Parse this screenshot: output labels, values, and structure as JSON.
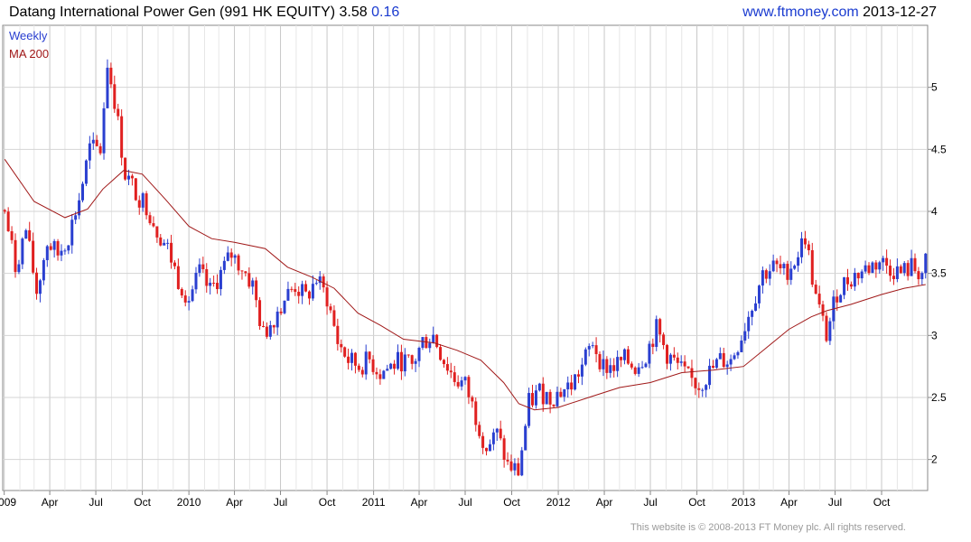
{
  "header": {
    "name": "Datang International Power Gen (991 HK EQUITY)",
    "price": "3.58",
    "change": "0.16",
    "site": "www.ftmoney.com",
    "date": "2013-12-27"
  },
  "footer": {
    "copyright": "This website is © 2008-2013 FT Money plc. All rights reserved."
  },
  "colors": {
    "up": "#2a3fd0",
    "down": "#e02020",
    "ma": "#a01818",
    "grid": "#d4d4d4",
    "axis": "#888888"
  },
  "chart_data": {
    "type": "line",
    "title": "Datang International Power Gen (991 HK EQUITY)",
    "legend": [
      "Weekly",
      "MA 200"
    ],
    "legend_position": "top-left",
    "y_axis_position": "right",
    "grid": true,
    "ylim": [
      1.75,
      5.5
    ],
    "xlim": [
      "2008-12-29",
      "2013-12-31"
    ],
    "yticks": [
      2,
      2.5,
      3,
      3.5,
      4,
      4.5,
      5
    ],
    "xticks": [
      {
        "label": "2009",
        "date": "2009-01-01"
      },
      {
        "label": "Apr",
        "date": "2009-04-01"
      },
      {
        "label": "Jul",
        "date": "2009-07-01"
      },
      {
        "label": "Oct",
        "date": "2009-10-01"
      },
      {
        "label": "2010",
        "date": "2010-01-01"
      },
      {
        "label": "Apr",
        "date": "2010-04-01"
      },
      {
        "label": "Jul",
        "date": "2010-07-01"
      },
      {
        "label": "Oct",
        "date": "2010-10-01"
      },
      {
        "label": "2011",
        "date": "2011-01-01"
      },
      {
        "label": "Apr",
        "date": "2011-04-01"
      },
      {
        "label": "Jul",
        "date": "2011-07-01"
      },
      {
        "label": "Oct",
        "date": "2011-10-01"
      },
      {
        "label": "2012",
        "date": "2012-01-01"
      },
      {
        "label": "Apr",
        "date": "2012-04-01"
      },
      {
        "label": "Jul",
        "date": "2012-07-01"
      },
      {
        "label": "Oct",
        "date": "2012-10-01"
      },
      {
        "label": "2013",
        "date": "2013-01-01"
      },
      {
        "label": "Apr",
        "date": "2013-04-01"
      },
      {
        "label": "Jul",
        "date": "2013-07-01"
      },
      {
        "label": "Oct",
        "date": "2013-10-01"
      }
    ],
    "series": [
      {
        "name": "Weekly",
        "points": [
          [
            "2009-01-02",
            4.0
          ],
          [
            "2009-01-23",
            3.55
          ],
          [
            "2009-02-13",
            3.85
          ],
          [
            "2009-03-06",
            3.35
          ],
          [
            "2009-03-27",
            3.75
          ],
          [
            "2009-04-17",
            3.65
          ],
          [
            "2009-05-08",
            3.8
          ],
          [
            "2009-05-29",
            4.1
          ],
          [
            "2009-06-19",
            4.5
          ],
          [
            "2009-07-10",
            4.5
          ],
          [
            "2009-07-24",
            5.2
          ],
          [
            "2009-08-07",
            4.9
          ],
          [
            "2009-08-28",
            4.3
          ],
          [
            "2009-09-18",
            4.15
          ],
          [
            "2009-10-09",
            4.05
          ],
          [
            "2009-10-30",
            3.85
          ],
          [
            "2009-11-20",
            3.7
          ],
          [
            "2009-12-11",
            3.45
          ],
          [
            "2010-01-01",
            3.3
          ],
          [
            "2010-01-22",
            3.5
          ],
          [
            "2010-02-12",
            3.35
          ],
          [
            "2010-03-05",
            3.5
          ],
          [
            "2010-03-26",
            3.65
          ],
          [
            "2010-04-16",
            3.55
          ],
          [
            "2010-05-07",
            3.4
          ],
          [
            "2010-05-28",
            3.0
          ],
          [
            "2010-06-18",
            3.15
          ],
          [
            "2010-07-09",
            3.3
          ],
          [
            "2010-07-30",
            3.4
          ],
          [
            "2010-08-20",
            3.3
          ],
          [
            "2010-09-10",
            3.45
          ],
          [
            "2010-10-01",
            3.3
          ],
          [
            "2010-10-22",
            2.95
          ],
          [
            "2010-11-12",
            2.8
          ],
          [
            "2010-12-03",
            2.75
          ],
          [
            "2010-12-24",
            2.8
          ],
          [
            "2011-01-14",
            2.7
          ],
          [
            "2011-02-04",
            2.75
          ],
          [
            "2011-02-25",
            2.8
          ],
          [
            "2011-03-18",
            2.75
          ],
          [
            "2011-04-08",
            2.95
          ],
          [
            "2011-04-29",
            3.0
          ],
          [
            "2011-05-20",
            2.8
          ],
          [
            "2011-06-10",
            2.65
          ],
          [
            "2011-07-01",
            2.6
          ],
          [
            "2011-07-22",
            2.35
          ],
          [
            "2011-08-12",
            2.1
          ],
          [
            "2011-09-02",
            2.2
          ],
          [
            "2011-09-23",
            1.95
          ],
          [
            "2011-10-14",
            1.9
          ],
          [
            "2011-11-04",
            2.45
          ],
          [
            "2011-11-25",
            2.55
          ],
          [
            "2011-12-16",
            2.5
          ],
          [
            "2012-01-06",
            2.55
          ],
          [
            "2012-01-27",
            2.6
          ],
          [
            "2012-02-17",
            2.75
          ],
          [
            "2012-03-09",
            2.95
          ],
          [
            "2012-03-30",
            2.75
          ],
          [
            "2012-04-20",
            2.75
          ],
          [
            "2012-05-11",
            2.8
          ],
          [
            "2012-06-01",
            2.75
          ],
          [
            "2012-06-22",
            2.85
          ],
          [
            "2012-07-13",
            3.05
          ],
          [
            "2012-08-03",
            2.85
          ],
          [
            "2012-08-24",
            2.75
          ],
          [
            "2012-09-14",
            2.65
          ],
          [
            "2012-10-05",
            2.6
          ],
          [
            "2012-10-26",
            2.7
          ],
          [
            "2012-11-16",
            2.8
          ],
          [
            "2012-12-07",
            2.8
          ],
          [
            "2012-12-28",
            3.0
          ],
          [
            "2013-01-18",
            3.25
          ],
          [
            "2013-02-08",
            3.5
          ],
          [
            "2013-03-01",
            3.55
          ],
          [
            "2013-03-22",
            3.5
          ],
          [
            "2013-04-12",
            3.6
          ],
          [
            "2013-05-03",
            3.8
          ],
          [
            "2013-05-24",
            3.3
          ],
          [
            "2013-06-14",
            3.0
          ],
          [
            "2013-07-05",
            3.35
          ],
          [
            "2013-07-26",
            3.45
          ],
          [
            "2013-08-16",
            3.5
          ],
          [
            "2013-09-06",
            3.55
          ],
          [
            "2013-09-27",
            3.6
          ],
          [
            "2013-10-18",
            3.55
          ],
          [
            "2013-11-08",
            3.5
          ],
          [
            "2013-11-29",
            3.55
          ],
          [
            "2013-12-20",
            3.5
          ],
          [
            "2013-12-27",
            3.58
          ]
        ]
      },
      {
        "name": "MA 200",
        "points": [
          [
            "2009-01-02",
            4.42
          ],
          [
            "2009-03-01",
            4.08
          ],
          [
            "2009-05-01",
            3.95
          ],
          [
            "2009-06-15",
            4.02
          ],
          [
            "2009-07-15",
            4.18
          ],
          [
            "2009-08-25",
            4.33
          ],
          [
            "2009-10-01",
            4.3
          ],
          [
            "2009-11-15",
            4.1
          ],
          [
            "2010-01-01",
            3.88
          ],
          [
            "2010-02-15",
            3.78
          ],
          [
            "2010-04-01",
            3.75
          ],
          [
            "2010-06-01",
            3.7
          ],
          [
            "2010-07-15",
            3.55
          ],
          [
            "2010-09-01",
            3.47
          ],
          [
            "2010-10-15",
            3.38
          ],
          [
            "2010-12-01",
            3.18
          ],
          [
            "2011-01-15",
            3.08
          ],
          [
            "2011-03-01",
            2.97
          ],
          [
            "2011-05-01",
            2.94
          ],
          [
            "2011-06-15",
            2.88
          ],
          [
            "2011-08-01",
            2.8
          ],
          [
            "2011-09-15",
            2.62
          ],
          [
            "2011-10-15",
            2.45
          ],
          [
            "2011-11-15",
            2.4
          ],
          [
            "2012-01-01",
            2.42
          ],
          [
            "2012-03-01",
            2.5
          ],
          [
            "2012-05-01",
            2.58
          ],
          [
            "2012-07-01",
            2.62
          ],
          [
            "2012-09-01",
            2.7
          ],
          [
            "2012-11-01",
            2.72
          ],
          [
            "2013-01-01",
            2.75
          ],
          [
            "2013-02-15",
            2.9
          ],
          [
            "2013-04-01",
            3.05
          ],
          [
            "2013-05-15",
            3.15
          ],
          [
            "2013-06-15",
            3.2
          ],
          [
            "2013-08-01",
            3.25
          ],
          [
            "2013-10-01",
            3.33
          ],
          [
            "2013-11-15",
            3.38
          ],
          [
            "2013-12-27",
            3.41
          ]
        ]
      }
    ]
  }
}
